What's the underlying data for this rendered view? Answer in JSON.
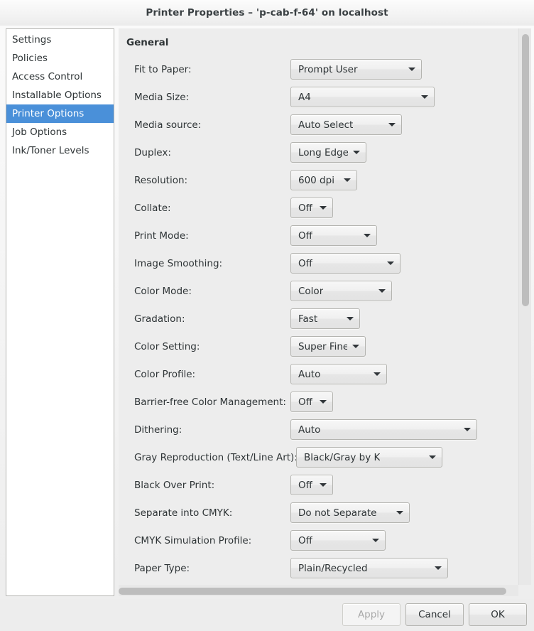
{
  "window": {
    "title": "Printer Properties – 'p-cab-f-64' on localhost"
  },
  "sidebar": {
    "items": [
      {
        "label": "Settings",
        "selected": false
      },
      {
        "label": "Policies",
        "selected": false
      },
      {
        "label": "Access Control",
        "selected": false
      },
      {
        "label": "Installable Options",
        "selected": false
      },
      {
        "label": "Printer Options",
        "selected": true
      },
      {
        "label": "Job Options",
        "selected": false
      },
      {
        "label": "Ink/Toner Levels",
        "selected": false
      }
    ],
    "selected_label": "Printer Options",
    "selection_color": "#4a90d9"
  },
  "main": {
    "group_title": "General",
    "options": [
      {
        "label": "Fit to Paper:",
        "value": "Prompt User",
        "combo_width": 185,
        "indent": 232
      },
      {
        "label": "Media Size:",
        "value": "A4",
        "combo_width": 203,
        "indent": 232
      },
      {
        "label": "Media source:",
        "value": "Auto Select",
        "combo_width": 157,
        "indent": 232
      },
      {
        "label": "Duplex:",
        "value": "Long Edge",
        "combo_width": 107,
        "indent": 232
      },
      {
        "label": "Resolution:",
        "value": "600 dpi",
        "combo_width": 94,
        "indent": 232
      },
      {
        "label": "Collate:",
        "value": "Off",
        "combo_width": 60,
        "indent": 232
      },
      {
        "label": "Print Mode:",
        "value": "Off",
        "combo_width": 122,
        "indent": 232
      },
      {
        "label": "Image Smoothing:",
        "value": "Off",
        "combo_width": 155,
        "indent": 232
      },
      {
        "label": "Color Mode:",
        "value": "Color",
        "combo_width": 143,
        "indent": 232
      },
      {
        "label": "Gradation:",
        "value": "Fast",
        "combo_width": 98,
        "indent": 232
      },
      {
        "label": "Color Setting:",
        "value": "Super Fine",
        "combo_width": 106,
        "indent": 232
      },
      {
        "label": "Color Profile:",
        "value": "Auto",
        "combo_width": 136,
        "indent": 232
      },
      {
        "label": "Barrier-free Color Management:",
        "value": "Off",
        "combo_width": 60,
        "indent": 232
      },
      {
        "label": "Dithering:",
        "value": "Auto",
        "combo_width": 263,
        "indent": 232
      },
      {
        "label": "Gray Reproduction (Text/Line Art):",
        "value": "Black/Gray by K",
        "combo_width": 206,
        "indent": 240
      },
      {
        "label": "Black Over Print:",
        "value": "Off",
        "combo_width": 60,
        "indent": 232
      },
      {
        "label": "Separate into CMYK:",
        "value": "Do not Separate",
        "combo_width": 168,
        "indent": 232
      },
      {
        "label": "CMYK Simulation Profile:",
        "value": "Off",
        "combo_width": 134,
        "indent": 232
      },
      {
        "label": "Paper Type:",
        "value": "Plain/Recycled",
        "combo_width": 222,
        "indent": 232
      }
    ]
  },
  "scrollbars": {
    "vertical": {
      "thumb_top_pct": 1,
      "thumb_height_pct": 49
    },
    "horizontal": {
      "thumb_left_pct": 0,
      "thumb_width_pct": 97
    }
  },
  "footer": {
    "apply_label": "Apply",
    "apply_disabled": true,
    "cancel_label": "Cancel",
    "ok_label": "OK"
  }
}
